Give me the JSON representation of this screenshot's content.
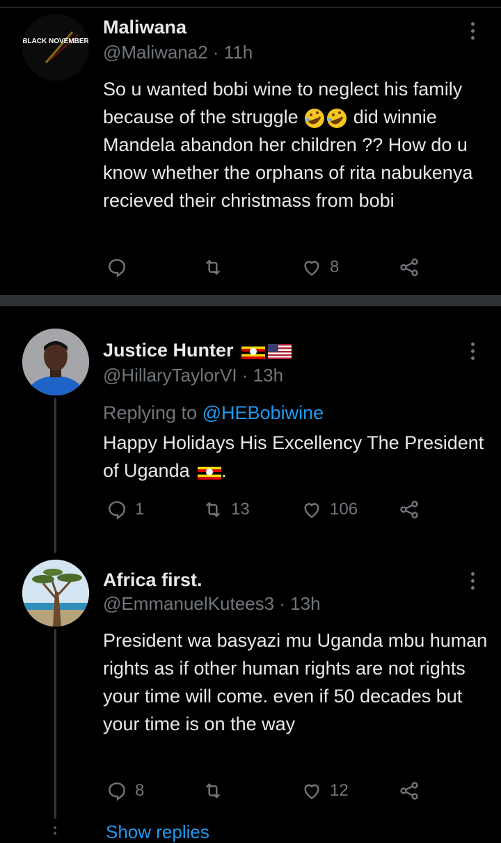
{
  "tweets": [
    {
      "avatar_text": "BLACK NOVEMBER",
      "name": "Maliwana",
      "handle_time": "@Maliwana2 · 11h",
      "body": "So u wanted bobi wine to neglect his family because of the struggle 🤣🤣 did winnie Mandela abandon her children ?? How do u know whether the orphans of rita nabukenya recieved their christmass from bobi",
      "actions": {
        "replies": "",
        "retweets": "",
        "likes": "8"
      }
    },
    {
      "name": "Justice Hunter",
      "handle_time": "@HillaryTaylorVI · 13h",
      "replying_prefix": "Replying to",
      "replying_to": "@HEBobiwine",
      "body": "Happy Holidays His Excellency The President of Uganda 🇺🇬.",
      "actions": {
        "replies": "1",
        "retweets": "13",
        "likes": "106"
      }
    },
    {
      "name": "Africa first.",
      "handle_time": "@EmmanuelKutees3 · 13h",
      "body": "President wa basyazi mu Uganda mbu human rights as if other human rights are not rights your time will come. even if 50 decades but your time is on the way",
      "actions": {
        "replies": "8",
        "retweets": "",
        "likes": "12"
      }
    }
  ],
  "show_replies": "Show replies",
  "colors": {
    "background": "#000000",
    "text": "#e7e9ea",
    "muted": "#71767b",
    "link": "#1d9bf0",
    "divider": "#2f3336"
  },
  "icons": [
    "reply-icon",
    "retweet-icon",
    "like-icon",
    "share-icon",
    "more-icon",
    "uganda-flag-icon",
    "usa-flag-icon",
    "rofl-emoji-icon"
  ]
}
